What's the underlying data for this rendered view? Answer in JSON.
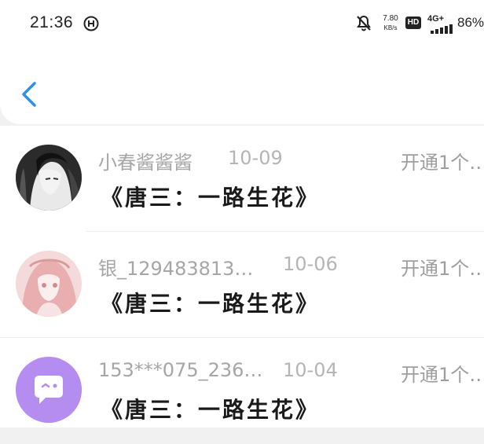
{
  "status_bar": {
    "time": "21:36",
    "network_speed_value": "7.80",
    "network_speed_unit": "KB/s",
    "hd_label": "HD",
    "network_type": "4G+",
    "battery_percent": "86%",
    "icons": [
      "notification-app-icon",
      "mute-icon",
      "signal-icon"
    ]
  },
  "nav": {
    "back_icon": "chevron-left-icon",
    "accent": "#2f8fe6"
  },
  "list": {
    "items": [
      {
        "username": "小春酱酱酱",
        "date": "10-09",
        "action": "开通1个…",
        "title": "《唐三：一路生花》",
        "avatar": "illustrated-portrait-dark-hair"
      },
      {
        "username": "银_129483813…",
        "date": "10-06",
        "action": "开通1个…",
        "title": "《唐三：一路生花》",
        "avatar": "illustrated-portrait-pink-hair"
      },
      {
        "username": "153***075_236…",
        "date": "10-04",
        "action": "开通1个…",
        "title": "《唐三：一路生花》",
        "avatar": "default-chat-bubble-avatar"
      }
    ]
  }
}
